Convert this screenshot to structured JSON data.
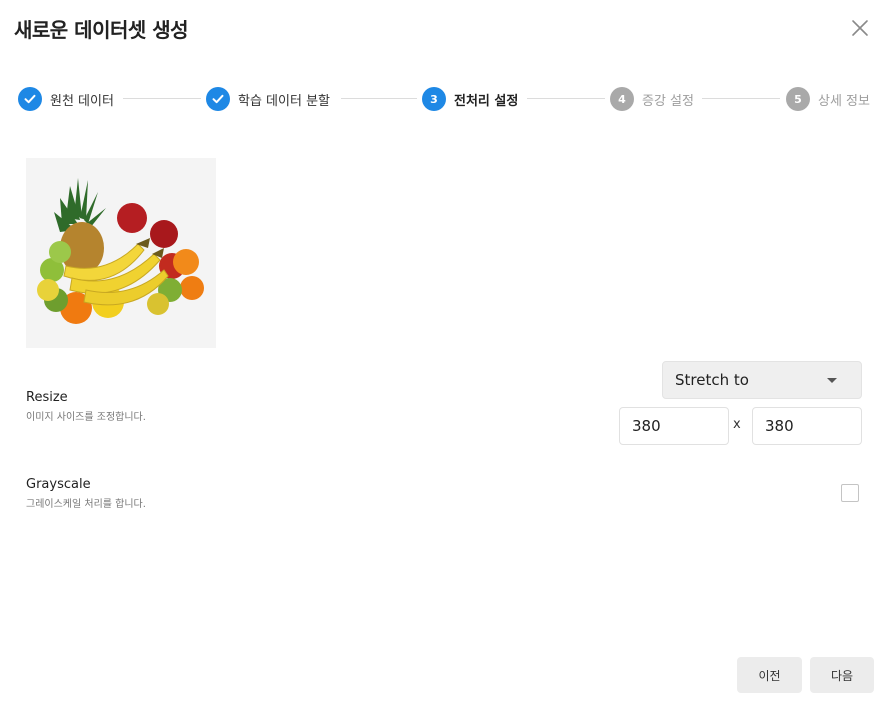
{
  "dialog": {
    "title": "새로운 데이터셋 생성",
    "close_icon": "close-icon"
  },
  "steps": [
    {
      "label": "원천 데이터",
      "state": "done",
      "icon": "check-icon"
    },
    {
      "label": "학습 데이터 분할",
      "state": "done",
      "icon": "check-icon"
    },
    {
      "label": "전처리 설정",
      "state": "active",
      "number": "3"
    },
    {
      "label": "증강 설정",
      "state": "pending",
      "number": "4"
    },
    {
      "label": "상세 정보",
      "state": "pending",
      "number": "5"
    }
  ],
  "colors": {
    "accent": "#1e88e5",
    "pending": "#a9a9a9",
    "button_bg": "#ececec"
  },
  "preview": {
    "subject": "fruit-assortment-image"
  },
  "resize": {
    "name": "Resize",
    "description": "이미지 사이즈를 조정합니다.",
    "mode": "Stretch to",
    "width": "380",
    "separator": "x",
    "height": "380"
  },
  "grayscale": {
    "name": "Grayscale",
    "description": "그레이스케일 처리를 합니다.",
    "checked": false
  },
  "footer": {
    "prev_label": "이전",
    "next_label": "다음"
  }
}
